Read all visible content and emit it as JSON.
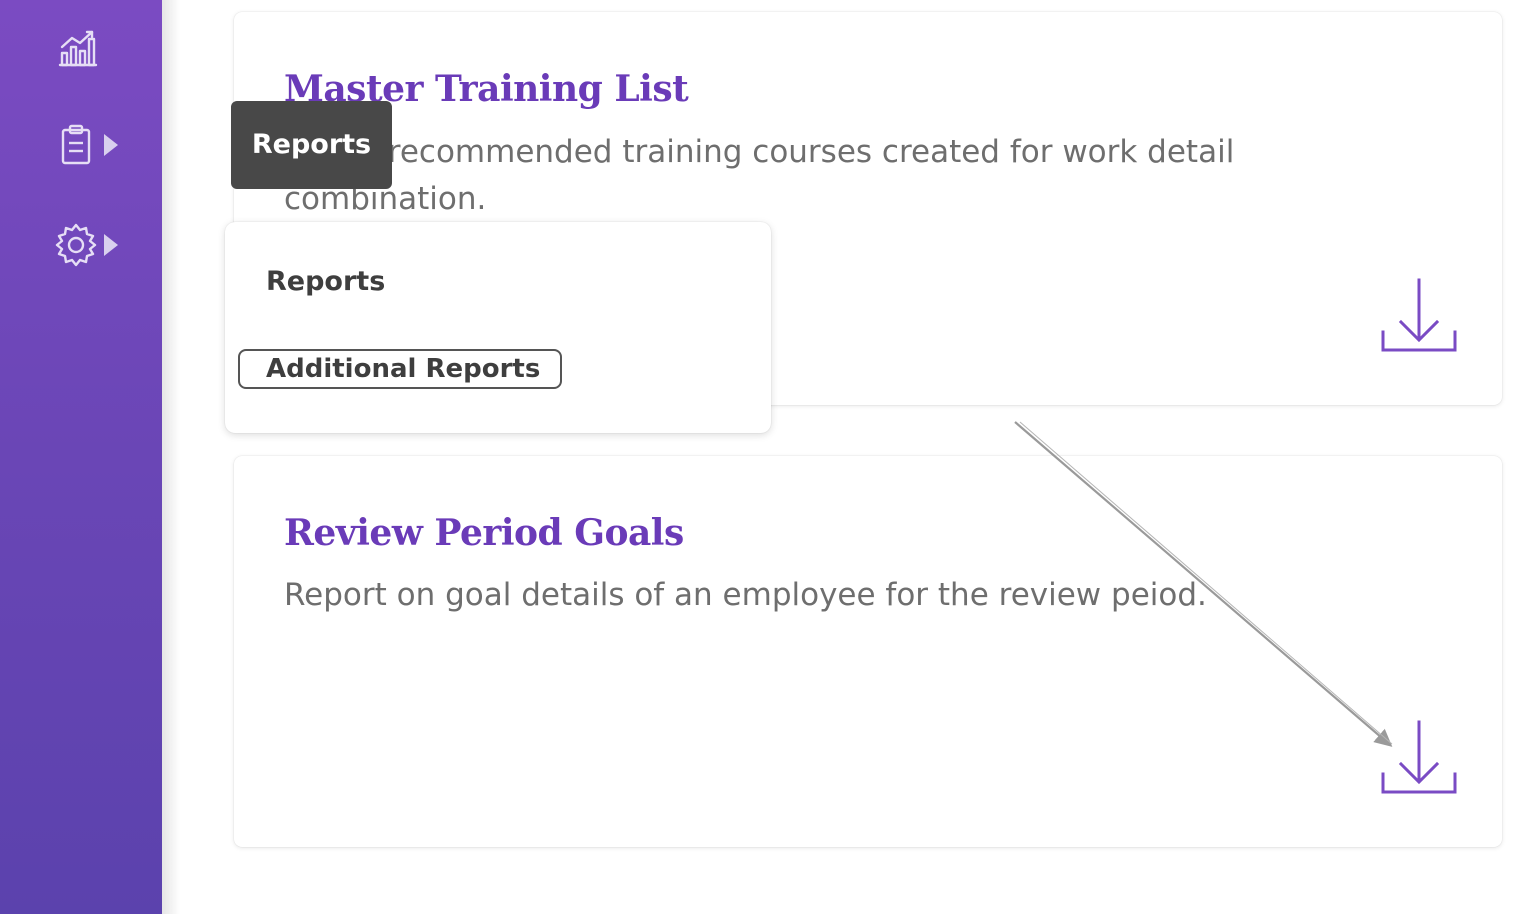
{
  "sidebar": {
    "items": [
      {
        "name": "analytics",
        "icon": "bar-chart-icon",
        "has_submenu": false
      },
      {
        "name": "reports",
        "icon": "clipboard-icon",
        "has_submenu": true
      },
      {
        "name": "settings",
        "icon": "gear-icon",
        "has_submenu": true
      }
    ],
    "colors": {
      "gradient_top": "#7b4bc2",
      "gradient_bottom": "#5b42ad"
    }
  },
  "tooltip": {
    "text": "Reports"
  },
  "flyout": {
    "heading": "Reports",
    "items": [
      {
        "label": "Additional Reports",
        "focused": true
      }
    ]
  },
  "cards": [
    {
      "title": "Master Training List",
      "description": "List of recommended training courses created for work detail combination.",
      "action_icon": "download-icon"
    },
    {
      "title": "Review Period Goals",
      "description": "Report on goal details of an employee for the review peiod.",
      "action_icon": "download-icon"
    }
  ],
  "colors": {
    "accent": "#6a3bb8",
    "text_muted": "#6e6e6e",
    "tooltip_bg": "#484848"
  }
}
